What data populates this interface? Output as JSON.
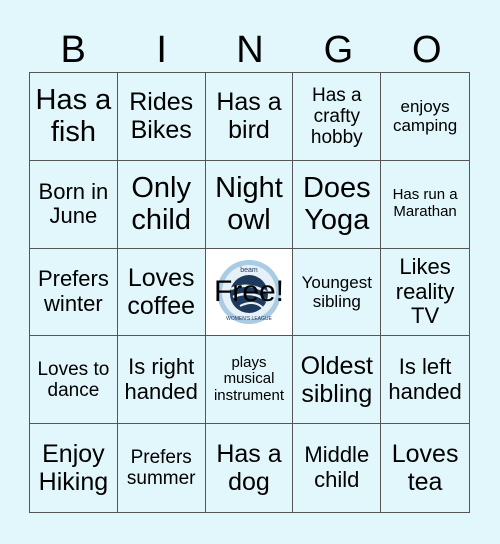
{
  "header": {
    "letters": [
      "B",
      "I",
      "N",
      "G",
      "O"
    ]
  },
  "colors": {
    "background": "#e1f7fb",
    "free_cell": "#ffffff",
    "grid_line": "#555555",
    "logo_primary": "#1d3a5c",
    "logo_secondary": "#a9cbe3"
  },
  "free_space": {
    "label": "Free!",
    "logo_top_text": "beam",
    "logo_bottom_text": "WOMEN'S LEAGUE"
  },
  "cells": [
    "Has a fish",
    "Rides Bikes",
    "Has a bird",
    "Has a crafty hobby",
    "enjoys camping",
    "Born in June",
    "Only child",
    "Night owl",
    "Does Yoga",
    "Has run a Marathan",
    "Prefers winter",
    "Loves coffee",
    "Free!",
    "Youngest sibling",
    "Likes reality TV",
    "Loves to dance",
    "Is right handed",
    "plays musical instrument",
    "Oldest sibling",
    "Is left handed",
    "Enjoy Hiking",
    "Prefers summer",
    "Has a dog",
    "Middle child",
    "Loves tea"
  ]
}
